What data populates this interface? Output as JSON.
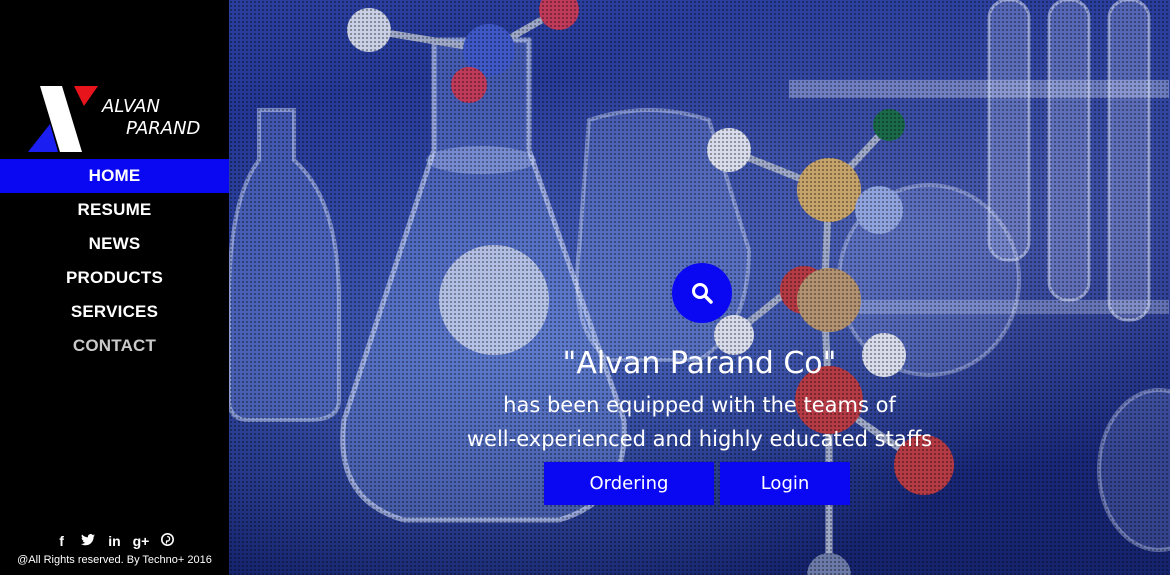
{
  "brand": {
    "line1": "ALVAN",
    "line2": "PARAND",
    "colors": {
      "red": "#e8141c",
      "blue": "#1a1ef0",
      "white": "#ffffff"
    }
  },
  "nav": {
    "items": [
      {
        "label": "HOME",
        "active": true
      },
      {
        "label": "RESUME",
        "active": false
      },
      {
        "label": "NEWS",
        "active": false
      },
      {
        "label": "PRODUCTS",
        "active": false
      },
      {
        "label": "SERVICES",
        "active": false
      },
      {
        "label": "CONTACT",
        "active": false
      }
    ]
  },
  "social": {
    "facebook": "f",
    "twitter": "t",
    "linkedin": "in",
    "googleplus": "g+",
    "pinterest": "p"
  },
  "footer": {
    "copyright": "@All Rights reserved. By Techno+ 2016"
  },
  "hero": {
    "search_icon": "search-icon",
    "headline": "\"Alvan Parand Co\"",
    "subline1": "has been equipped with the teams of",
    "subline2": "well-experienced and highly educated staffs",
    "order_label": "Ordering",
    "login_label": "Login"
  },
  "colors": {
    "accent": "#0a07f2",
    "sidebar": "#000000"
  }
}
